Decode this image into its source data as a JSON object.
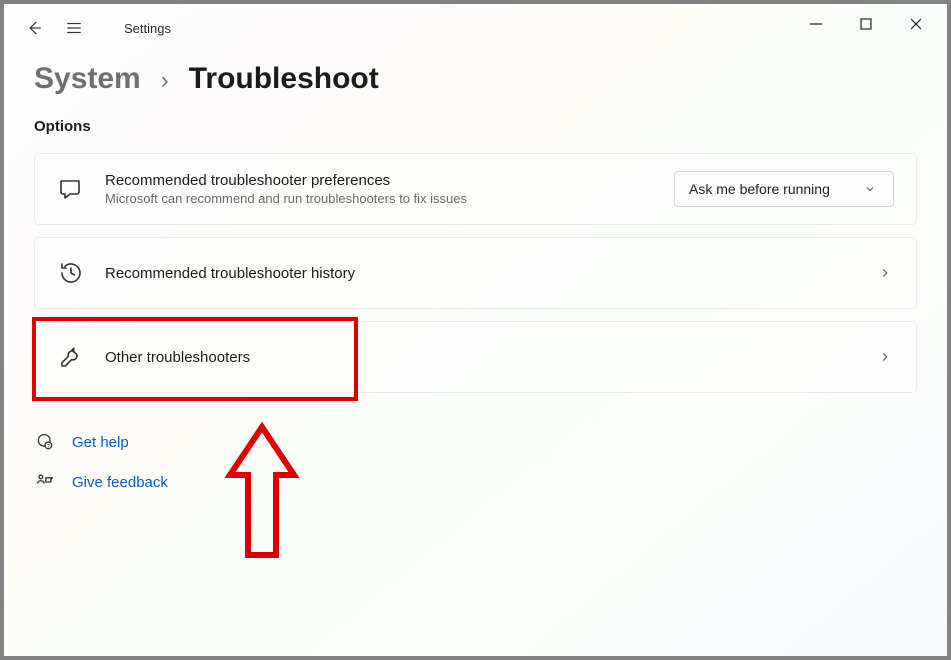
{
  "app": {
    "title": "Settings"
  },
  "breadcrumb": {
    "parent": "System",
    "separator": "›",
    "current": "Troubleshoot"
  },
  "section": {
    "options_label": "Options"
  },
  "cards": {
    "preferences": {
      "title": "Recommended troubleshooter preferences",
      "subtitle": "Microsoft can recommend and run troubleshooters to fix issues",
      "dropdown_value": "Ask me before running"
    },
    "history": {
      "title": "Recommended troubleshooter history"
    },
    "other": {
      "title": "Other troubleshooters"
    }
  },
  "links": {
    "help": "Get help",
    "feedback": "Give feedback"
  }
}
